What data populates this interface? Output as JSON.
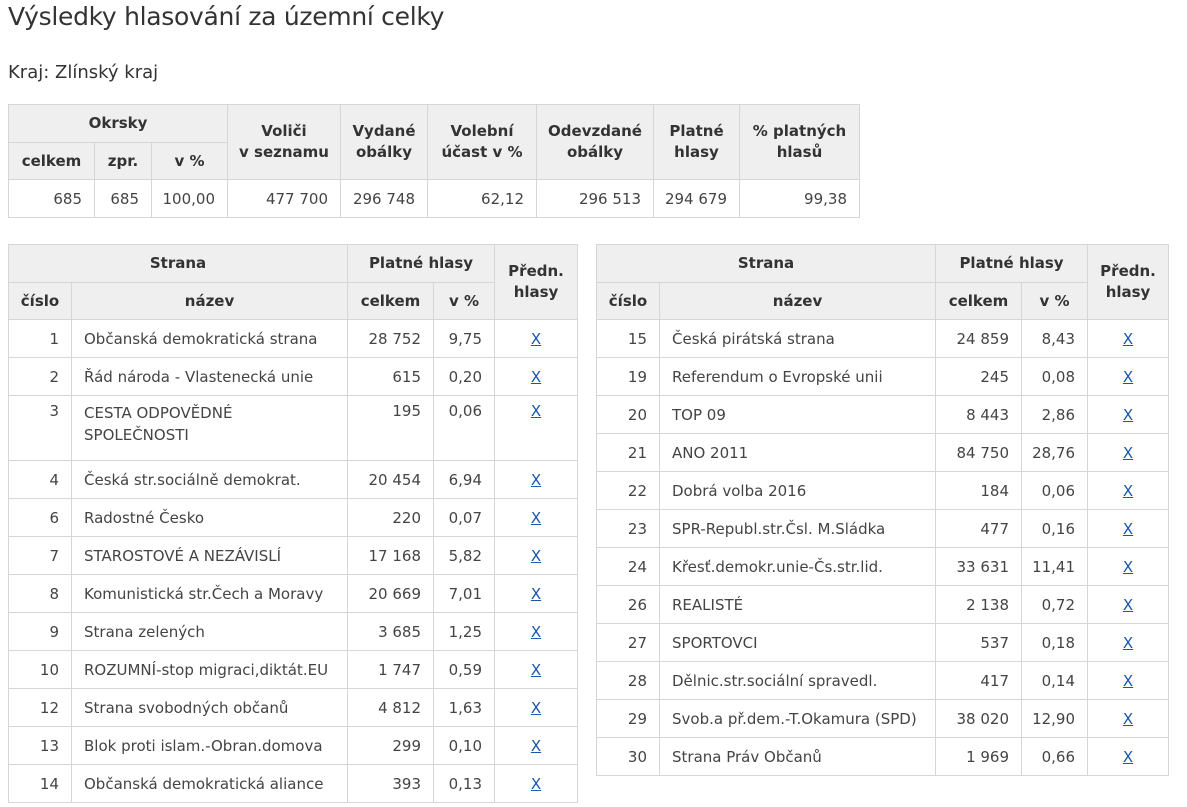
{
  "page": {
    "title": "Výsledky hlasování za územní celky",
    "region": "Kraj: Zlínský kraj"
  },
  "summary": {
    "headers": {
      "okrsky": "Okrsky",
      "celkem": "celkem",
      "zpr": "zpr.",
      "v_pct": "v %",
      "volici_line1": "Voliči",
      "volici_line2": "v seznamu",
      "vydane_line1": "Vydané",
      "vydane_line2": "obálky",
      "ucast_line1": "Volební",
      "ucast_line2": "účast v %",
      "odevzdane_line1": "Odevzdané",
      "odevzdane_line2": "obálky",
      "platne_line1": "Platné",
      "platne_line2": "hlasy",
      "pct_platnych_line1": "% platných",
      "pct_platnych_line2": "hlasů"
    },
    "values": {
      "okrsky_celkem": "685",
      "okrsky_zpr": "685",
      "okrsky_pct": "100,00",
      "volici": "477 700",
      "vydane": "296 748",
      "ucast": "62,12",
      "odevzdane": "296 513",
      "platne": "294 679",
      "pct_platnych": "99,38"
    }
  },
  "party_headers": {
    "strana": "Strana",
    "platne_hlasy": "Platné hlasy",
    "predn_line1": "Předn.",
    "predn_line2": "hlasy",
    "cislo": "číslo",
    "nazev": "název",
    "celkem": "celkem",
    "v_pct": "v %"
  },
  "left_parties": [
    {
      "cislo": "1",
      "nazev": "Občanská demokratická strana",
      "celkem": "28 752",
      "pct": "9,75",
      "link": "X"
    },
    {
      "cislo": "2",
      "nazev": "Řád národa - Vlastenecká unie",
      "celkem": "615",
      "pct": "0,20",
      "link": "X"
    },
    {
      "cislo": "3",
      "nazev_line1": "CESTA ODPOVĚDNÉ",
      "nazev_line2": "SPOLEČNOSTI",
      "celkem": "195",
      "pct": "0,06",
      "link": "X"
    },
    {
      "cislo": "4",
      "nazev": "Česká str.sociálně demokrat.",
      "celkem": "20 454",
      "pct": "6,94",
      "link": "X"
    },
    {
      "cislo": "6",
      "nazev": "Radostné Česko",
      "celkem": "220",
      "pct": "0,07",
      "link": "X"
    },
    {
      "cislo": "7",
      "nazev": "STAROSTOVÉ A NEZÁVISLÍ",
      "celkem": "17 168",
      "pct": "5,82",
      "link": "X"
    },
    {
      "cislo": "8",
      "nazev": "Komunistická str.Čech a Moravy",
      "celkem": "20 669",
      "pct": "7,01",
      "link": "X"
    },
    {
      "cislo": "9",
      "nazev": "Strana zelených",
      "celkem": "3 685",
      "pct": "1,25",
      "link": "X"
    },
    {
      "cislo": "10",
      "nazev": "ROZUMNÍ-stop migraci,diktát.EU",
      "celkem": "1 747",
      "pct": "0,59",
      "link": "X"
    },
    {
      "cislo": "12",
      "nazev": "Strana svobodných občanů",
      "celkem": "4 812",
      "pct": "1,63",
      "link": "X"
    },
    {
      "cislo": "13",
      "nazev": "Blok proti islam.-Obran.domova",
      "celkem": "299",
      "pct": "0,10",
      "link": "X"
    },
    {
      "cislo": "14",
      "nazev": "Občanská demokratická aliance",
      "celkem": "393",
      "pct": "0,13",
      "link": "X"
    }
  ],
  "right_parties": [
    {
      "cislo": "15",
      "nazev": "Česká pirátská strana",
      "celkem": "24 859",
      "pct": "8,43",
      "link": "X"
    },
    {
      "cislo": "19",
      "nazev": "Referendum o Evropské unii",
      "celkem": "245",
      "pct": "0,08",
      "link": "X"
    },
    {
      "cislo": "20",
      "nazev": "TOP 09",
      "celkem": "8 443",
      "pct": "2,86",
      "link": "X"
    },
    {
      "cislo": "21",
      "nazev": "ANO 2011",
      "celkem": "84 750",
      "pct": "28,76",
      "link": "X"
    },
    {
      "cislo": "22",
      "nazev": "Dobrá volba 2016",
      "celkem": "184",
      "pct": "0,06",
      "link": "X"
    },
    {
      "cislo": "23",
      "nazev": "SPR-Republ.str.Čsl. M.Sládka",
      "celkem": "477",
      "pct": "0,16",
      "link": "X"
    },
    {
      "cislo": "24",
      "nazev": "Křesť.demokr.unie-Čs.str.lid.",
      "celkem": "33 631",
      "pct": "11,41",
      "link": "X"
    },
    {
      "cislo": "26",
      "nazev": "REALISTÉ",
      "celkem": "2 138",
      "pct": "0,72",
      "link": "X"
    },
    {
      "cislo": "27",
      "nazev": "SPORTOVCI",
      "celkem": "537",
      "pct": "0,18",
      "link": "X"
    },
    {
      "cislo": "28",
      "nazev": "Dělnic.str.sociální spravedl.",
      "celkem": "417",
      "pct": "0,14",
      "link": "X"
    },
    {
      "cislo": "29",
      "nazev": "Svob.a př.dem.-T.Okamura (SPD)",
      "celkem": "38 020",
      "pct": "12,90",
      "link": "X"
    },
    {
      "cislo": "30",
      "nazev": "Strana Práv Občanů",
      "celkem": "1 969",
      "pct": "0,66",
      "link": "X"
    }
  ]
}
